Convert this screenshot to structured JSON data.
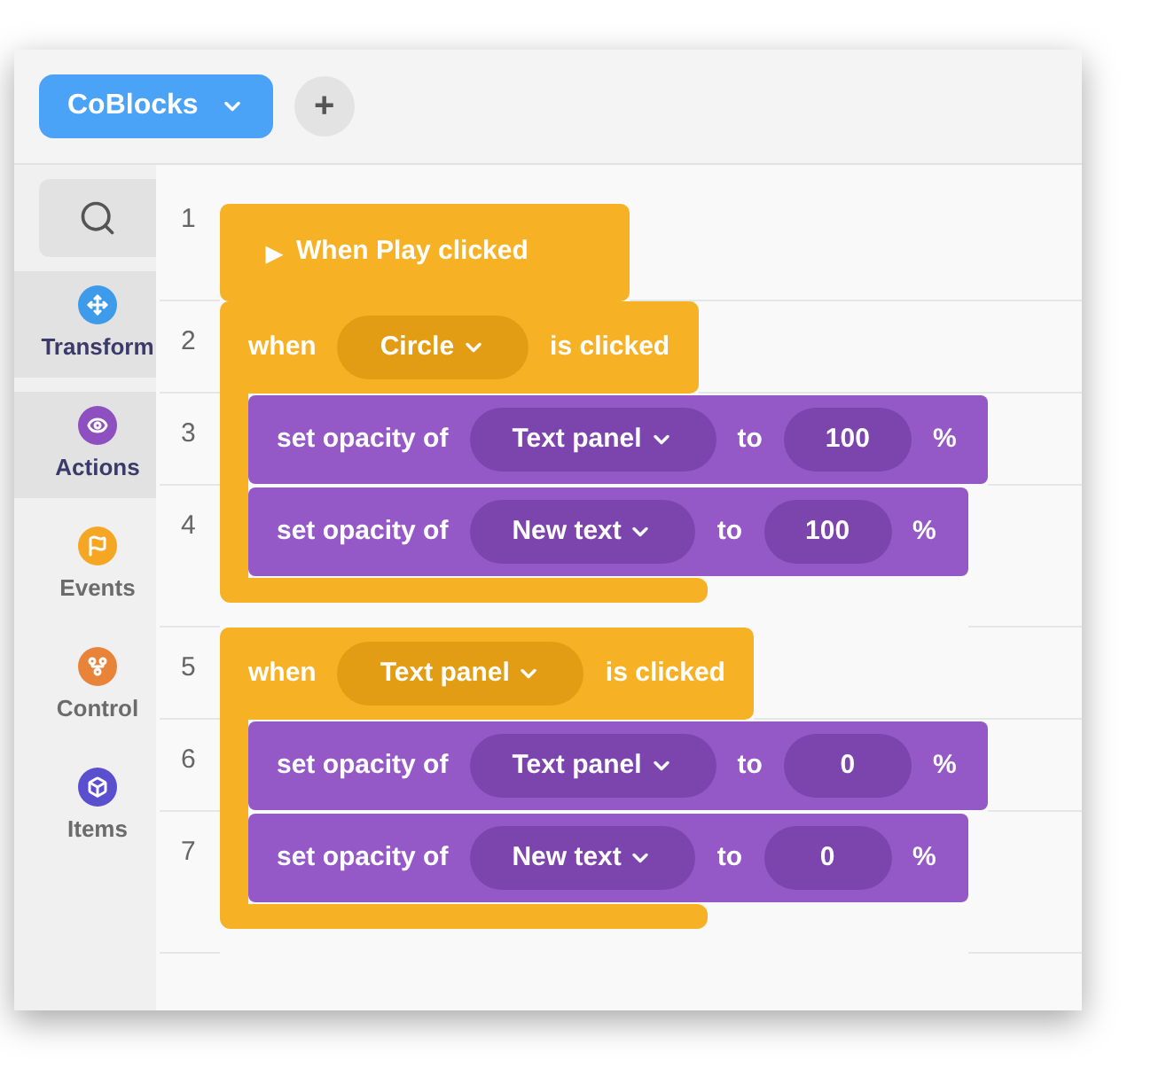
{
  "toolbar": {
    "project_menu": "CoBlocks",
    "add_button": "+"
  },
  "sidebar": {
    "items": [
      {
        "kind": "transform",
        "label": "Transform",
        "selected": true,
        "color": "#3d9be9"
      },
      {
        "kind": "actions",
        "label": "Actions",
        "selected": true,
        "color": "#8e4fc1"
      },
      {
        "kind": "events",
        "label": "Events",
        "selected": false,
        "color": "#f5a623"
      },
      {
        "kind": "control",
        "label": "Control",
        "selected": false,
        "color": "#e8843a"
      },
      {
        "kind": "items",
        "label": "Items",
        "selected": false,
        "color": "#5a4fcf"
      }
    ]
  },
  "scripts": [
    {
      "kind": "start",
      "line": "1",
      "icon": "▶",
      "label": "When Play clicked"
    },
    {
      "kind": "when",
      "line": "2",
      "prefix": "when",
      "target": "Circle",
      "suffix": "is clicked",
      "statements": [
        {
          "line": "3",
          "prefix": "set opacity of",
          "target": "Text panel",
          "to": "to",
          "value": "100",
          "unit": "%"
        },
        {
          "line": "4",
          "prefix": "set opacity of",
          "target": "New text",
          "to": "to",
          "value": "100",
          "unit": "%"
        }
      ]
    },
    {
      "kind": "when",
      "line": "5",
      "prefix": "when",
      "target": "Text panel",
      "suffix": "is clicked",
      "statements": [
        {
          "line": "6",
          "prefix": "set opacity of",
          "target": "Text panel",
          "to": "to",
          "value": "0",
          "unit": "%"
        },
        {
          "line": "7",
          "prefix": "set opacity of",
          "target": "New text",
          "to": "to",
          "value": "0",
          "unit": "%"
        }
      ]
    }
  ]
}
